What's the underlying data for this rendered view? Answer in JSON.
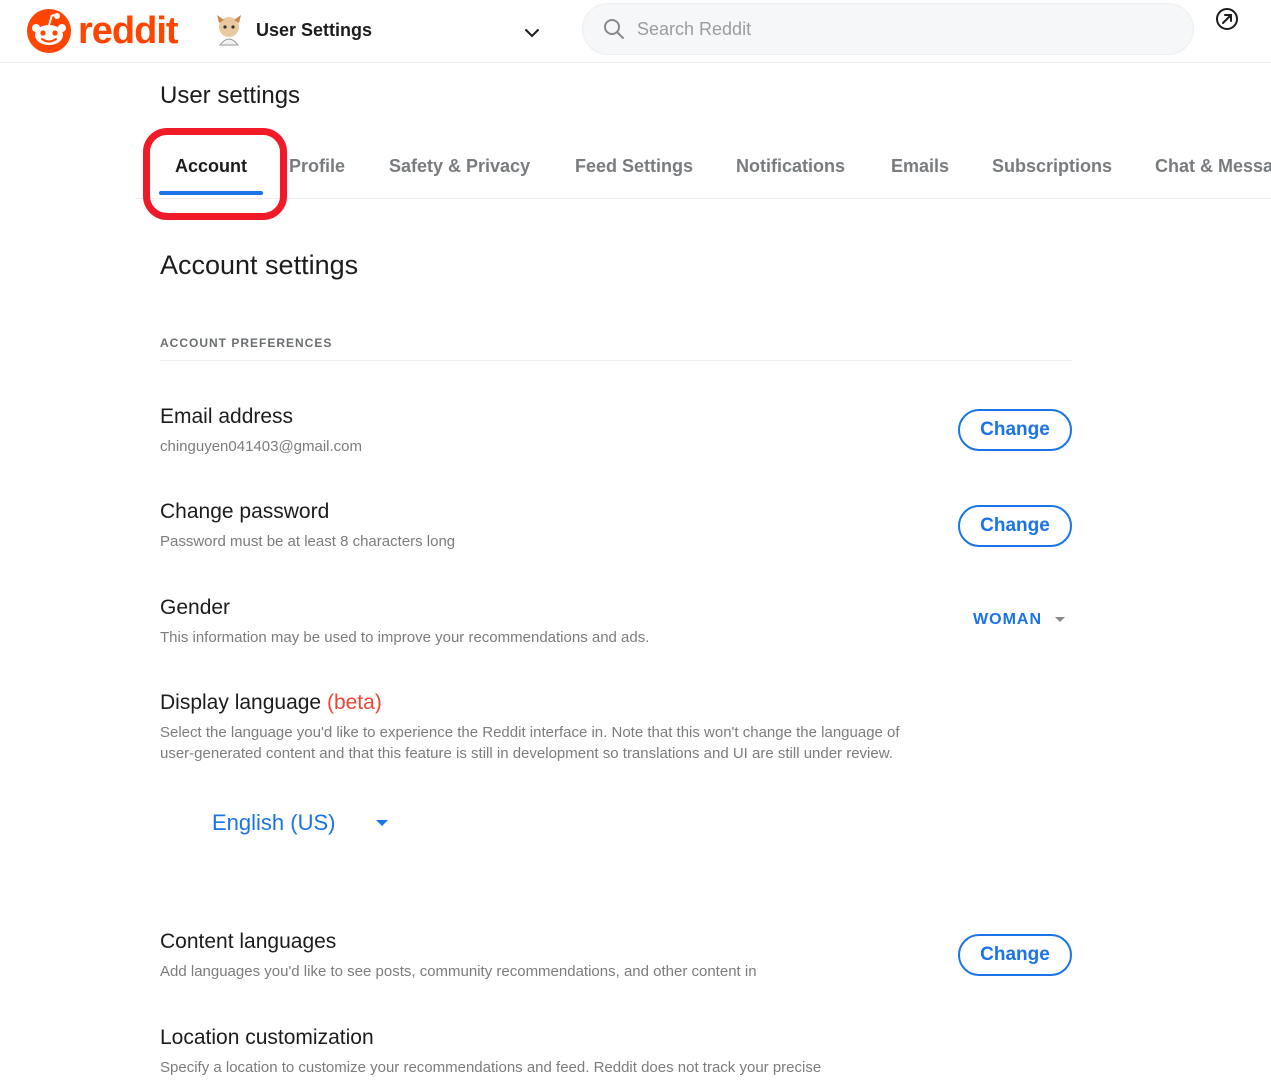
{
  "header": {
    "logo_text": "reddit",
    "context_label": "User Settings",
    "search_placeholder": "Search Reddit"
  },
  "page": {
    "title": "User settings"
  },
  "tabs": [
    {
      "label": "Account",
      "active": true
    },
    {
      "label": "Profile"
    },
    {
      "label": "Safety & Privacy"
    },
    {
      "label": "Feed Settings"
    },
    {
      "label": "Notifications"
    },
    {
      "label": "Emails"
    },
    {
      "label": "Subscriptions"
    },
    {
      "label": "Chat & Messa"
    }
  ],
  "account": {
    "section_title": "Account settings",
    "group_heading": "ACCOUNT PREFERENCES",
    "email": {
      "title": "Email address",
      "value": "chinguyen041403@gmail.com",
      "button": "Change"
    },
    "password": {
      "title": "Change password",
      "desc": "Password must be at least 8 characters long",
      "button": "Change"
    },
    "gender": {
      "title": "Gender",
      "desc": "This information may be used to improve your recommendations and ads.",
      "value": "WOMAN"
    },
    "display_language": {
      "title": "Display language",
      "beta": "(beta)",
      "desc": "Select the language you'd like to experience the Reddit interface in. Note that this won't change the language of user-generated content and that this feature is still in development so translations and UI are still under review.",
      "value": "English (US)"
    },
    "content_languages": {
      "title": "Content languages",
      "desc": "Add languages you'd like to see posts, community recommendations, and other content in",
      "button": "Change"
    },
    "location": {
      "title": "Location customization",
      "desc": "Specify a location to customize your recommendations and feed. Reddit does not track your precise"
    }
  },
  "colors": {
    "brand": "#ff4500",
    "accent": "#1a73e8",
    "highlight": "#ef1b29",
    "beta": "#e8473a"
  },
  "icons": [
    "reddit-logo-icon",
    "chevron-down-icon",
    "search-icon",
    "popular-icon",
    "caret-down-icon"
  ]
}
